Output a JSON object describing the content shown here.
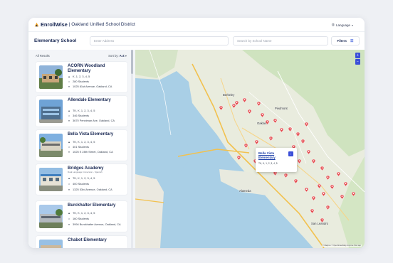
{
  "header": {
    "brand": "EnrollWise",
    "district": "| Oakland Unified School District",
    "language_label": "Language"
  },
  "search": {
    "title": "Elementary School",
    "address_placeholder": "Enter Address",
    "school_placeholder": "Search by School Name",
    "filters_label": "Filters"
  },
  "list": {
    "count_label": "All Results",
    "sort_label": "Sort by:",
    "sort_value": "A-Z",
    "schools": [
      {
        "name": "ACORN Woodland Elementary",
        "grades": "K, 1, 2, 3, 4, 5",
        "students": "280 Students",
        "address": "1025 81st Avenue, Oakland, CA"
      },
      {
        "name": "Allendale Elementary",
        "grades": "TK, K, 1, 2, 3, 4, 5",
        "students": "346 Students",
        "address": "3670 Penniman Ave, Oakland, CA"
      },
      {
        "name": "Bella Vista Elementary",
        "grades": "TK, K, 1, 2, 3, 4, 5",
        "students": "401 Students",
        "address": "1025 E 28th Street, Oakland, CA"
      },
      {
        "name": "Bridges Academy",
        "subtitle": "Dual Language Immersion - Spanish",
        "grades": "TK, K, 1, 2, 3, 4, 5",
        "students": "400 Students",
        "address": "1325 53rd Avenue, Oakland, CA"
      },
      {
        "name": "Burckhalter Elementary",
        "grades": "TK, K, 1, 2, 3, 4, 5",
        "students": "160 Students",
        "address": "3994 Burckhalter Avenue, Oakland, CA"
      },
      {
        "name": "Chabot Elementary"
      }
    ]
  },
  "map": {
    "popup": {
      "name": "Bella Vista Elementary",
      "grades": "TK, K, 1, 2, 3, 4, 5"
    },
    "labels": [
      "Berkeley",
      "Alameda",
      "Oakland",
      "San Leandro",
      "Piedmont"
    ],
    "attribution": "© Mapbox © OpenStreetMap Improve this map",
    "pin_color": "#e5484d"
  },
  "icons": {
    "grades": "cap-icon",
    "students": "person-icon",
    "address": "location-icon",
    "filters": "sliders-icon",
    "language": "globe-icon"
  }
}
